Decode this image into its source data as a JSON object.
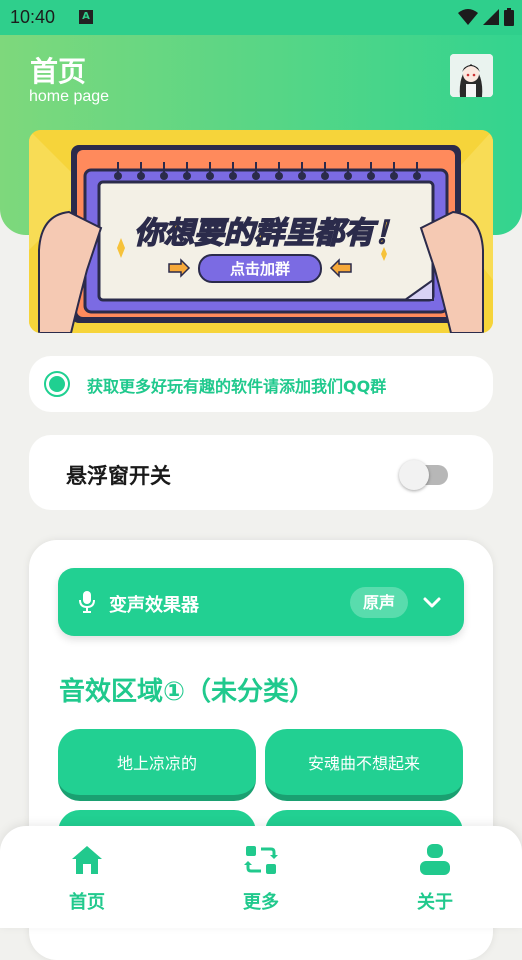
{
  "status_bar": {
    "time": "10:40",
    "notification_letter": "A"
  },
  "header": {
    "title": "首页",
    "subtitle": "home page"
  },
  "banner": {
    "headline": "你想要的群里都有！",
    "button_label": "点击加群"
  },
  "notice": {
    "text": "获取更多好玩有趣的软件请添加我们QQ群"
  },
  "floating_window": {
    "label": "悬浮窗开关",
    "enabled": false
  },
  "voice_changer": {
    "label": "变声效果器",
    "current_effect": "原声"
  },
  "sound_section": {
    "title": "音效区域①（未分类）",
    "buttons": [
      "地上凉凉的",
      "安魂曲不想起来",
      "",
      ""
    ]
  },
  "bottom_nav": {
    "items": [
      {
        "label": "首页",
        "icon": "home-icon"
      },
      {
        "label": "更多",
        "icon": "refresh-icon"
      },
      {
        "label": "关于",
        "icon": "user-icon"
      }
    ]
  },
  "colors": {
    "accent": "#22d092",
    "header_start": "#7ed87c",
    "header_end": "#33d48f",
    "banner_bg": "#f6d43a"
  }
}
